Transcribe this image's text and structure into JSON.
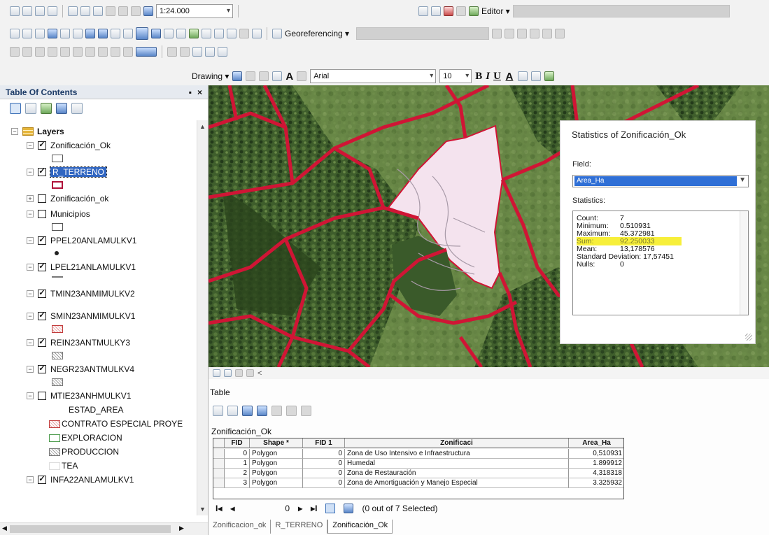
{
  "toolbars": {
    "scale_value": "1:24.000",
    "editor_label": "Editor ▾",
    "georeferencing_label": "Georeferencing ▾",
    "drawing_label": "Drawing ▾",
    "text_tool": "A",
    "font_name": "Arial",
    "font_size": "10",
    "bold": "B",
    "italic": "I",
    "underline": "U",
    "font_color": "A",
    "colors": {
      "accent_blue": "#3166c1",
      "map_border": "#d01535",
      "highlight": "#f7ef3a"
    }
  },
  "toc": {
    "title": "Table Of Contents",
    "pin": "▪",
    "close": "×",
    "root_label": "Layers",
    "layers": [
      {
        "label": "Zonificación_Ok",
        "checked": true,
        "expander": "−",
        "symbol": "rect",
        "selected": false
      },
      {
        "label": "R_TERRENO",
        "checked": true,
        "expander": "−",
        "symbol": "redrect",
        "selected": true
      },
      {
        "label": "Zonificación_ok",
        "checked": false,
        "expander": "+",
        "symbol": "",
        "selected": false
      },
      {
        "label": "Municipios",
        "checked": false,
        "expander": "−",
        "symbol": "rect",
        "selected": false
      },
      {
        "label": "PPEL20ANLAMULKV1",
        "checked": true,
        "expander": "−",
        "symbol": "dot",
        "selected": false
      },
      {
        "label": "LPEL21ANLAMULKV1",
        "checked": true,
        "expander": "−",
        "symbol": "line",
        "selected": false
      },
      {
        "label": "TMIN23ANMIMULKV2",
        "checked": true,
        "expander": "−",
        "symbol": "",
        "selected": false
      },
      {
        "label": "SMIN23ANMIMULKV1",
        "checked": true,
        "expander": "−",
        "symbol": "redhatch",
        "selected": false
      },
      {
        "label": "REIN23ANTMULKY3",
        "checked": true,
        "expander": "−",
        "symbol": "hatch",
        "selected": false
      },
      {
        "label": "NEGR23ANTMULKV4",
        "checked": true,
        "expander": "−",
        "symbol": "hatch",
        "selected": false
      },
      {
        "label": "MTIE23ANHMULKV1",
        "checked": false,
        "expander": "−",
        "symbol": "",
        "selected": false
      }
    ],
    "legend_field": "ESTAD_AREA",
    "legend_items": [
      {
        "label": "CONTRATO ESPECIAL PROYE",
        "symbol": "redhatch"
      },
      {
        "label": "EXPLORACION",
        "symbol": "greenrect"
      },
      {
        "label": "PRODUCCION",
        "symbol": "hatch"
      },
      {
        "label": "TEA",
        "symbol": "blank"
      }
    ],
    "last_layer": {
      "label": "INFA22ANLAMULKV1",
      "checked": true,
      "expander": "−"
    }
  },
  "stats": {
    "title": "Statistics of Zonificación_Ok",
    "field_label": "Field:",
    "field_value": "Area_Ha",
    "statistics_label": "Statistics:",
    "lines": [
      {
        "k": "Count:",
        "v": "7",
        "highlight": false
      },
      {
        "k": "Minimum:",
        "v": "0.510931",
        "highlight": false
      },
      {
        "k": "Maximum:",
        "v": "45.372981",
        "highlight": false
      },
      {
        "k": "Sum:",
        "v": "92.250033",
        "highlight": true
      },
      {
        "k": "Mean:",
        "v": "13,178576",
        "highlight": false
      },
      {
        "k": "Standard Deviation:",
        "v": "17,57451",
        "highlight": false
      },
      {
        "k": "Nulls:",
        "v": "0",
        "highlight": false
      }
    ]
  },
  "table": {
    "title": "Table",
    "layer_name": "Zonificación_Ok",
    "columns": [
      "FID",
      "Shape *",
      "FID 1",
      "Zonificaci",
      "Area_Ha"
    ],
    "rows": [
      [
        "0",
        "Polygon",
        "0",
        "Zona de Uso Intensivo e Infraestructura",
        "0,510931"
      ],
      [
        "1",
        "Polygon",
        "0",
        "Humedal",
        "1.899912"
      ],
      [
        "2",
        "Polygon",
        "0",
        "Zona de Restauración",
        "4,318318"
      ],
      [
        "3",
        "Polygon",
        "0",
        "Zona de Amortiguación y Manejo Especial",
        "3.325932"
      ]
    ],
    "nav": {
      "first": "I◂",
      "prev": "◂",
      "record": "0",
      "next": "▸",
      "last": "▸I",
      "selection": "(0 out of 7 Selected)"
    },
    "tabs": [
      {
        "label": "Zonificacion_ok",
        "active": false
      },
      {
        "label": "R_TERRENO",
        "active": false
      },
      {
        "label": "Zonificación_Ok",
        "active": true
      }
    ]
  }
}
